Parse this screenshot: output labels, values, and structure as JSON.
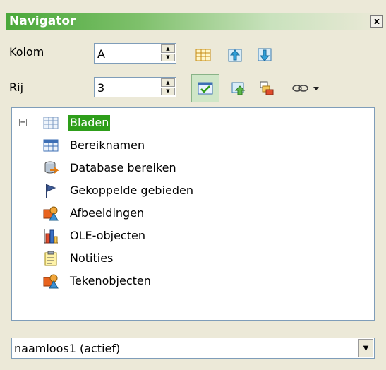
{
  "window": {
    "title": "Navigator",
    "close_glyph": "x"
  },
  "column": {
    "label": "Kolom",
    "value": "A"
  },
  "row": {
    "label": "Rij",
    "value": "3"
  },
  "toolbar": {
    "buttons": [
      {
        "icon": "data-range-icon"
      },
      {
        "icon": "start-icon"
      },
      {
        "icon": "end-icon"
      },
      {
        "icon": "contents-toggle-icon",
        "active": true
      },
      {
        "icon": "scenarios-icon"
      },
      {
        "icon": "drag-mode-icon"
      },
      {
        "icon": "link-icon"
      }
    ]
  },
  "tree": {
    "items": [
      {
        "label": "Bladen",
        "icon": "sheets-icon",
        "expandable": true,
        "selected": true
      },
      {
        "label": "Bereiknamen",
        "icon": "range-names-icon"
      },
      {
        "label": "Database bereiken",
        "icon": "database-icon"
      },
      {
        "label": "Gekoppelde gebieden",
        "icon": "flag-icon"
      },
      {
        "label": "Afbeeldingen",
        "icon": "image-icon"
      },
      {
        "label": "OLE-objecten",
        "icon": "chart-icon"
      },
      {
        "label": "Notities",
        "icon": "note-icon"
      },
      {
        "label": "Tekenobjecten",
        "icon": "drawing-icon"
      }
    ]
  },
  "document_select": {
    "value": "naamloos1 (actief)"
  }
}
